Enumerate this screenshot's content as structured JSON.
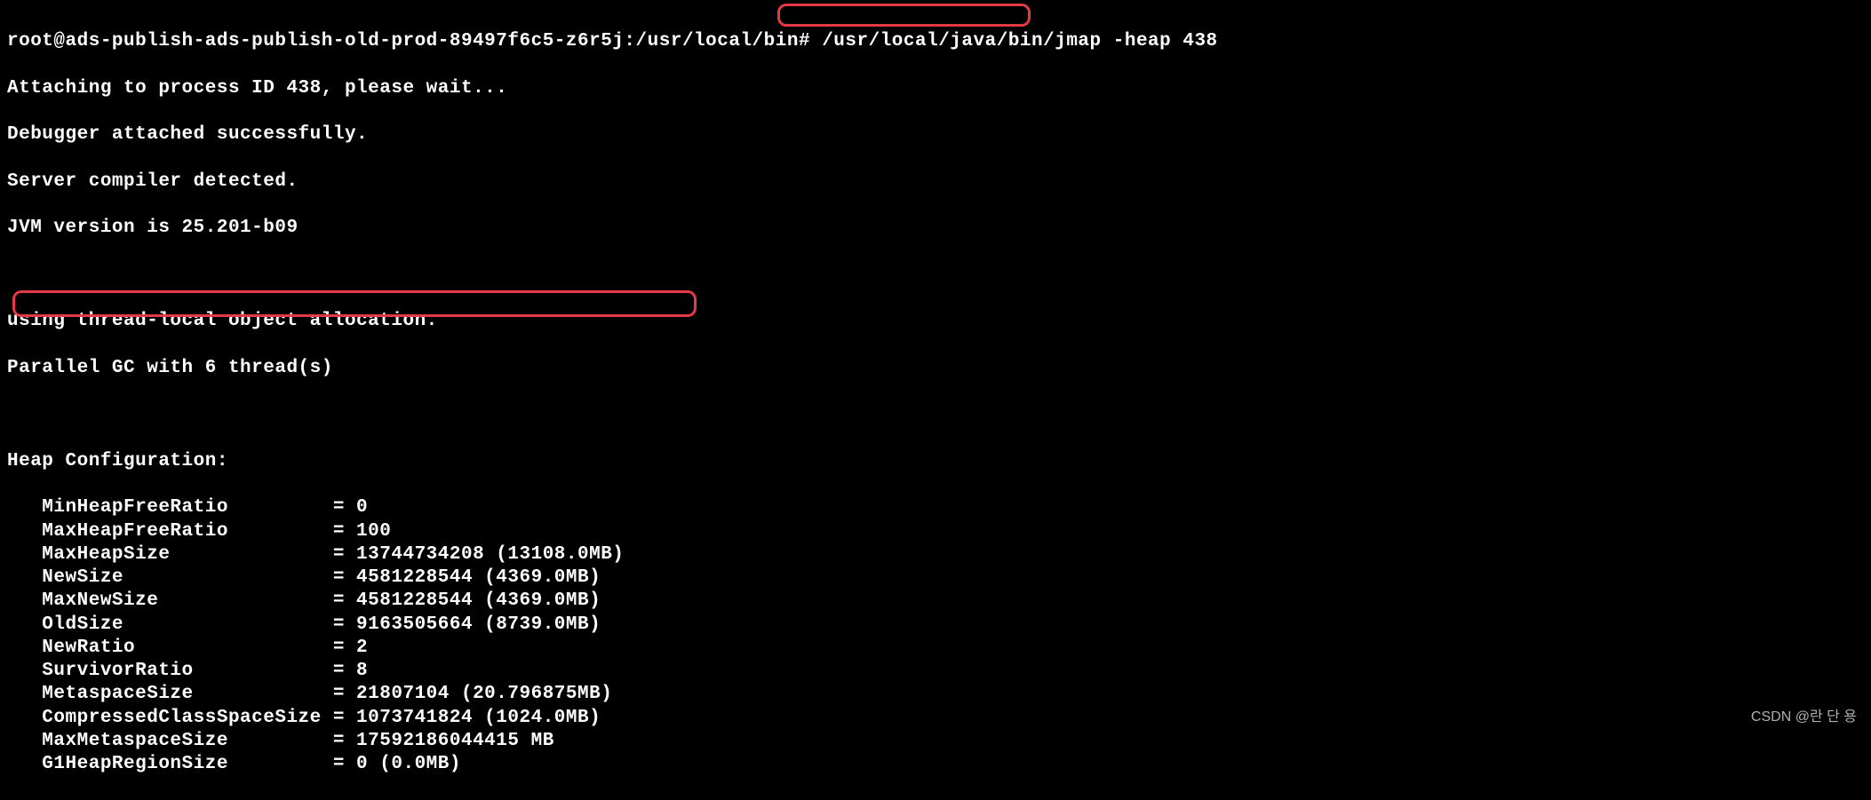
{
  "prompt": {
    "user_host": "root@ads-publish-ads-publish-old-prod-89497f6c5-z6r5j",
    "cwd": "/usr/local/bin",
    "symbol": "#",
    "command": "/usr/local/java/bin/jmap -heap 438"
  },
  "output": {
    "attach": "Attaching to process ID 438, please wait...",
    "debugger": "Debugger attached successfully.",
    "compiler": "Server compiler detected.",
    "jvm_version": "JVM version is 25.201-b09",
    "allocation": "using thread-local object allocation.",
    "gc": "Parallel GC with 6 thread(s)",
    "heap_header": "Heap Configuration:"
  },
  "heap_config": [
    {
      "name": "MinHeapFreeRatio",
      "eq": "=",
      "value": "0"
    },
    {
      "name": "MaxHeapFreeRatio",
      "eq": "=",
      "value": "100"
    },
    {
      "name": "MaxHeapSize",
      "eq": "=",
      "value": "13744734208 (13108.0MB)"
    },
    {
      "name": "NewSize",
      "eq": "=",
      "value": "4581228544 (4369.0MB)"
    },
    {
      "name": "MaxNewSize",
      "eq": "=",
      "value": "4581228544 (4369.0MB)"
    },
    {
      "name": "OldSize",
      "eq": "=",
      "value": "9163505664 (8739.0MB)"
    },
    {
      "name": "NewRatio",
      "eq": "=",
      "value": "2"
    },
    {
      "name": "SurvivorRatio",
      "eq": "=",
      "value": "8"
    },
    {
      "name": "MetaspaceSize",
      "eq": "=",
      "value": "21807104 (20.796875MB)"
    },
    {
      "name": "CompressedClassSpaceSize",
      "eq": "=",
      "value": "1073741824 (1024.0MB)"
    },
    {
      "name": "MaxMetaspaceSize",
      "eq": "=",
      "value": "17592186044415 MB"
    },
    {
      "name": "G1HeapRegionSize",
      "eq": "=",
      "value": "0 (0.0MB)"
    }
  ],
  "watermark": "CSDN @란 단 용"
}
